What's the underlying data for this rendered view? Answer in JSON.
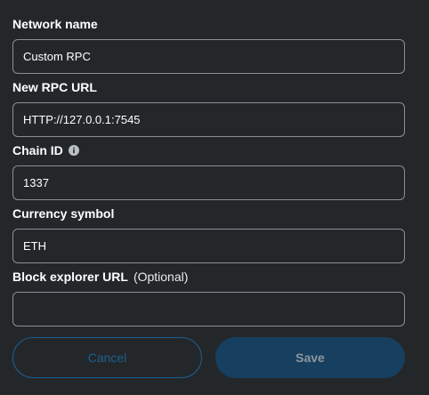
{
  "form": {
    "network_name": {
      "label": "Network name",
      "value": "Custom RPC"
    },
    "rpc_url": {
      "label": "New RPC URL",
      "value": "HTTP://127.0.0.1:7545"
    },
    "chain_id": {
      "label": "Chain ID",
      "value": "1337",
      "icon": "info-icon"
    },
    "currency_symbol": {
      "label": "Currency symbol",
      "value": "ETH"
    },
    "block_explorer": {
      "label": "Block explorer URL",
      "optional_label": "(Optional)",
      "value": ""
    }
  },
  "actions": {
    "cancel_label": "Cancel",
    "save_label": "Save"
  },
  "colors": {
    "background": "#24272a",
    "input_border": "#8a8f94",
    "cancel_accent": "#1e5f90",
    "save_background": "#173f5f",
    "save_text": "#8d96a0"
  }
}
